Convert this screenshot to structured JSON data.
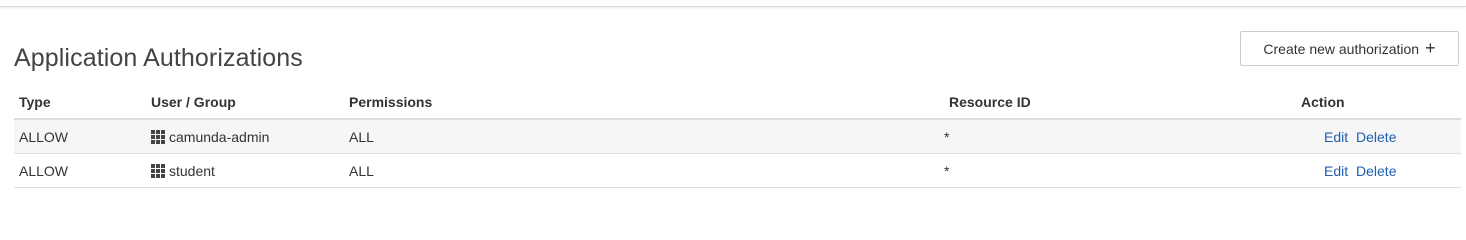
{
  "page": {
    "title": "Application Authorizations"
  },
  "toolbar": {
    "create_label": "Create new authorization",
    "create_icon": "plus-icon"
  },
  "table": {
    "columns": [
      "Type",
      "User / Group",
      "Permissions",
      "Resource ID",
      "Action"
    ],
    "rows": [
      {
        "type": "ALLOW",
        "user_icon": "group-grid-icon",
        "user": "camunda-admin",
        "permissions": "ALL",
        "resource_id": "*",
        "edit": "Edit",
        "delete": "Delete"
      },
      {
        "type": "ALLOW",
        "user_icon": "group-grid-icon",
        "user": "student",
        "permissions": "ALL",
        "resource_id": "*",
        "edit": "Edit",
        "delete": "Delete"
      }
    ]
  },
  "colors": {
    "link": "#1f5fb0",
    "row_stripe": "#f6f6f6",
    "border": "#dddddd"
  }
}
